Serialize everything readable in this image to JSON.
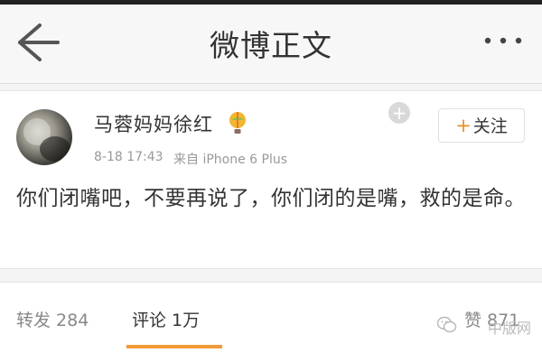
{
  "nav": {
    "title": "微博正文",
    "back_icon": "back-arrow-icon",
    "more_icon": "more-dots-icon"
  },
  "post": {
    "username": "马蓉妈妈徐红",
    "badge_icon": "hot-air-balloon-icon",
    "time": "8-18 17:43",
    "source": "来自 iPhone 6 Plus",
    "add_icon": "plus-circle-icon",
    "follow_plus": "+",
    "follow_label": "关注",
    "text": "你们闭嘴吧，不要再说了，你们闭的是嘴，救的是命。"
  },
  "tabs": {
    "repost": "转发 284",
    "comment": "评论 1万",
    "like": "赞 871",
    "active": "comment"
  },
  "watermark": {
    "icon": "wechat-icon",
    "text": "中版网"
  },
  "colors": {
    "accent": "#f29b38",
    "follow_plus": "#e8902a",
    "text": "#333333",
    "muted": "#999999"
  }
}
